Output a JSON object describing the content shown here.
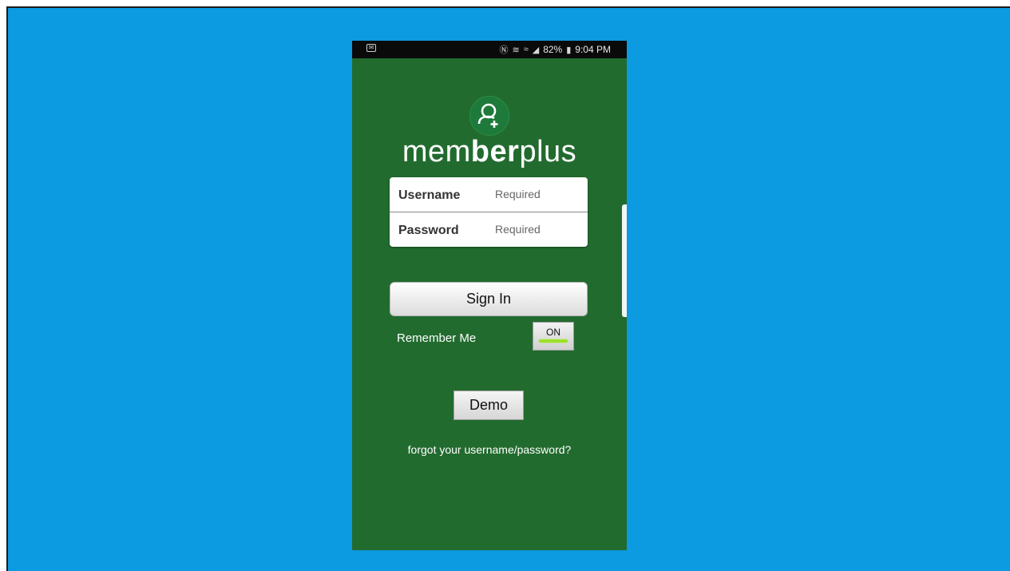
{
  "status_bar": {
    "icons": [
      "message-icon",
      "nfc-icon",
      "vibrate-icon",
      "wifi-icon",
      "signal-icon",
      "battery-icon"
    ],
    "battery": "82%",
    "time": "9:04 PM"
  },
  "app": {
    "logo_icon": "user-plus-icon",
    "brand_part1": "mem",
    "brand_part2": "ber",
    "brand_part3": "plus",
    "username_label": "Username",
    "username_placeholder": "Required",
    "password_label": "Password",
    "password_placeholder": "Required",
    "sign_in_label": "Sign In",
    "remember_label": "Remember Me",
    "remember_toggle": "ON",
    "demo_label": "Demo",
    "forgot_link": "forgot your username/password?"
  },
  "colors": {
    "background": "#0c9ae0",
    "app_background": "#226b2f",
    "toggle_on": "#9de02a"
  }
}
